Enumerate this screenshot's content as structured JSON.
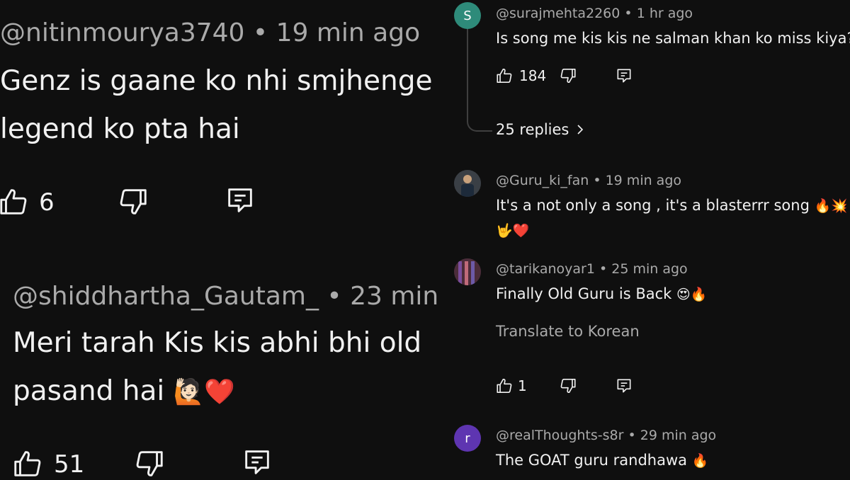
{
  "left": {
    "comment1": {
      "author": "@nitinmourya3740",
      "time": "19 min ago",
      "text_line1": "Genz is gaane ko nhi smjhenge",
      "text_line2": "legend ko pta hai",
      "likes": "6"
    },
    "comment2": {
      "author": "@shiddhartha_Gautam_",
      "time": "23 min",
      "text_line1": "Meri tarah Kis kis abhi bhi old",
      "text_line2": "pasand hai",
      "text_emoji": "🙋🏻❤️",
      "likes": "51"
    }
  },
  "right": {
    "c1": {
      "avatar_letter": "S",
      "avatar_color": "#2e8b7a",
      "author": "@surajmehta2260",
      "time": "1 hr ago",
      "text": "Is song me kis kis ne salman khan ko miss kiya?",
      "likes": "184",
      "replies_label": "25 replies"
    },
    "c2": {
      "author": "@Guru_ki_fan",
      "time": "19 min ago",
      "text_line1": "It's a not only a song , it's a blasterrr song",
      "text_line1_emoji": "🔥💥",
      "text_line2_emoji": "🤟❤️"
    },
    "c3": {
      "author": "@tarikanoyar1",
      "time": "25 min ago",
      "text": "Finally Old Guru is Back",
      "text_emoji": "😍🔥",
      "translate_label": "Translate to Korean",
      "likes": "1"
    },
    "c4": {
      "avatar_letter": "r",
      "avatar_color": "#5e35b1",
      "author": "@realThoughts-s8r",
      "time": "29 min ago",
      "text": "The GOAT guru randhawa",
      "text_emoji": "🔥"
    }
  },
  "separator": "•",
  "icons": [
    "thumbs-up-icon",
    "thumbs-down-icon",
    "reply-icon",
    "chevron-right-icon"
  ]
}
